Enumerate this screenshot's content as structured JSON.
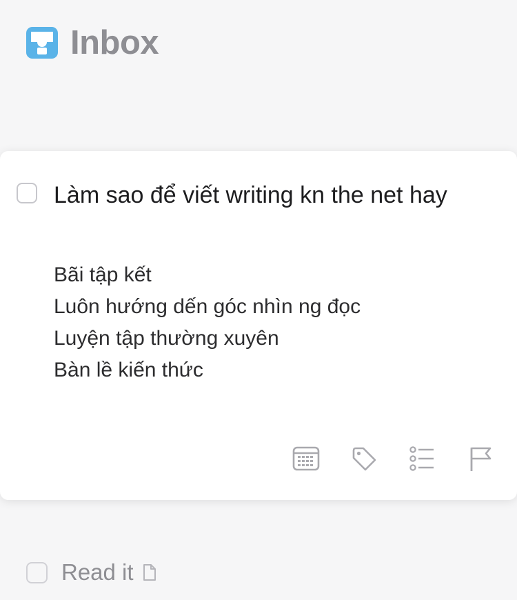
{
  "header": {
    "title": "Inbox",
    "icon": "inbox-tray-icon",
    "icon_color": "#5ab3e8"
  },
  "task": {
    "title": "Làm sao để viết writing kn the net hay",
    "completed": false,
    "notes": [
      "Bãi tập kết",
      "Luôn hướng dến góc nhìn ng đọc",
      "Luyện tập thường xuyên",
      "Bàn lề kiến thức"
    ],
    "toolbar": [
      {
        "name": "when",
        "icon": "calendar-icon"
      },
      {
        "name": "tags",
        "icon": "tag-icon"
      },
      {
        "name": "checklist",
        "icon": "checklist-icon"
      },
      {
        "name": "deadline",
        "icon": "flag-icon"
      }
    ]
  },
  "list": {
    "items": [
      {
        "title": "Read it",
        "completed": false,
        "has_notes": true,
        "note_icon": "document-icon"
      }
    ]
  },
  "colors": {
    "background": "#f6f6f7",
    "card": "#ffffff",
    "title_gray": "#8e8e93",
    "icon_gray": "#a9a9ae"
  }
}
